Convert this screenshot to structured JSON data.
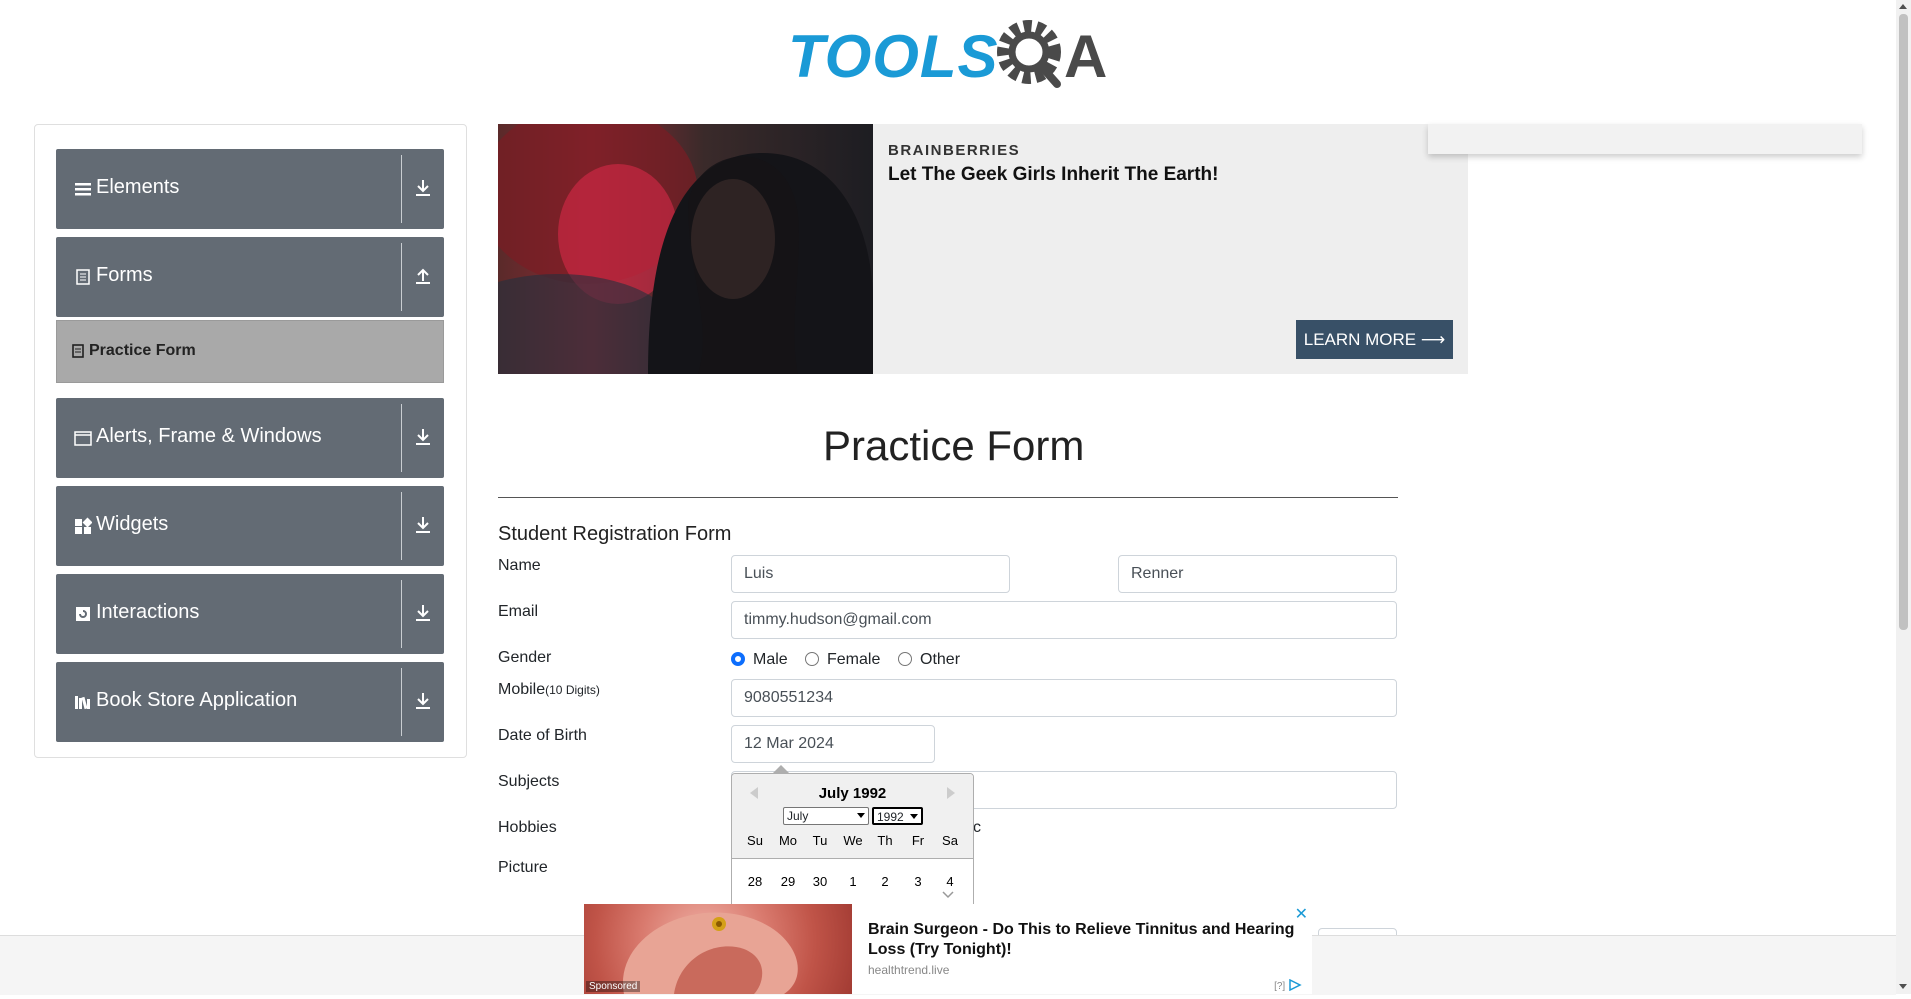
{
  "header": {
    "logo_text": "TOOLS",
    "logo_letter": "A"
  },
  "sidebar": {
    "groups": [
      {
        "label": "Elements",
        "icon": "hamburger-icon",
        "expanded": false
      },
      {
        "label": "Forms",
        "icon": "document-icon",
        "expanded": true
      },
      {
        "label": "Alerts, Frame & Windows",
        "icon": "window-icon",
        "expanded": false
      },
      {
        "label": "Widgets",
        "icon": "widgets-icon",
        "expanded": false
      },
      {
        "label": "Interactions",
        "icon": "interactions-icon",
        "expanded": false
      },
      {
        "label": "Book Store Application",
        "icon": "books-icon",
        "expanded": false
      }
    ],
    "active_item": {
      "label": "Practice Form",
      "icon": "form-icon"
    }
  },
  "ad_top": {
    "brand": "BRAINBERRIES",
    "headline": "Let The Geek Girls Inherit The Earth!",
    "cta": "LEARN MORE ⟶"
  },
  "form": {
    "page_title": "Practice Form",
    "subtitle": "Student Registration Form",
    "labels": {
      "name": "Name",
      "email": "Email",
      "gender": "Gender",
      "mobile": "Mobile",
      "mobile_hint": "(10 Digits)",
      "dob": "Date of Birth",
      "subjects": "Subjects",
      "hobbies": "Hobbies",
      "picture": "Picture"
    },
    "first_name": "Luis",
    "last_name": "Renner",
    "email": "timmy.hudson@gmail.com",
    "gender_options": [
      "Male",
      "Female",
      "Other"
    ],
    "gender_selected": "Male",
    "mobile": "9080551234",
    "dob": "12 Mar 2024",
    "hobbies_partial": "c"
  },
  "datepicker": {
    "month_title": "July 1992",
    "month_select": "July",
    "year_select": "1992",
    "day_names": [
      "Su",
      "Mo",
      "Tu",
      "We",
      "Th",
      "Fr",
      "Sa"
    ],
    "first_week": [
      "28",
      "29",
      "30",
      "1",
      "2",
      "3",
      "4"
    ]
  },
  "ad_bottom": {
    "sponsored": "Sponsored",
    "title": "Brain Surgeon - Do This to Relieve Tinnitus and Hearing Loss (Try Tonight)!",
    "domain": "healthtrend.live",
    "info": "[?]",
    "close": "✕"
  },
  "colors": {
    "sidebar_bg": "#636b74",
    "accent": "#0d6efd",
    "cta_bg": "#385067",
    "logo_blue": "#1a9ad6"
  }
}
